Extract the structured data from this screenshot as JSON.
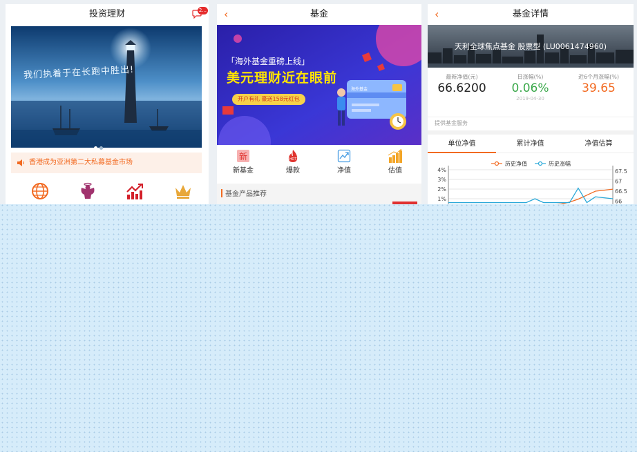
{
  "panel1": {
    "title": "投资理财",
    "badge": "2...",
    "banner_text": "我们执着于在长跑中胜出!",
    "notice": "香港成为亚洲第二大私募基金市场",
    "icons": [
      "globe-icon",
      "angel-icon",
      "trend-icon",
      "crown-icon"
    ]
  },
  "panel2": {
    "title": "基金",
    "banner": {
      "subtitle": "「海外基金重磅上线」",
      "title": "美元理财近在眼前",
      "promo": "开户有礼 豪送158元红包",
      "card_label": "海外基金"
    },
    "nav": [
      {
        "label": "新基金",
        "icon": "new-icon",
        "icon_text": "新"
      },
      {
        "label": "爆款",
        "icon": "hot-icon",
        "icon_text": "HOT"
      },
      {
        "label": "净值",
        "icon": "trend-chart-icon"
      },
      {
        "label": "估值",
        "icon": "bar-coins-icon"
      }
    ],
    "section_title": "基金产品推荐"
  },
  "panel3": {
    "title": "基金详情",
    "fund_name": "天利全球焦点基金 股票型 (LU0061474960)",
    "stats": [
      {
        "label": "最新净值(元)",
        "value": "66.6200",
        "date": ""
      },
      {
        "label": "日涨幅(%)",
        "value": "0.06%",
        "date": "2019-04-30"
      },
      {
        "label": "近6个月涨幅(%)",
        "value": "39.65",
        "date": ""
      }
    ],
    "service_label": "提供基金服务",
    "tabs": [
      "单位净值",
      "累计净值",
      "净值估算"
    ],
    "active_tab": 0
  },
  "colors": {
    "accent": "#f26a21",
    "green": "#3aa84a",
    "red_badge": "#e52b2b"
  },
  "chart_data": {
    "type": "line",
    "title": "",
    "legend": [
      "历史净值",
      "历史涨幅"
    ],
    "y_left_ticks": [
      "4%",
      "3%",
      "2%",
      "1%"
    ],
    "y_right_ticks": [
      "67.5",
      "67",
      "66.5",
      "66"
    ],
    "series": [
      {
        "name": "历史净值",
        "color": "#f26a21",
        "axis": "right",
        "values": [
          65.8,
          65.8,
          65.8,
          65.8,
          65.8,
          65.8,
          65.8,
          65.8,
          65.8,
          65.8,
          65.8,
          65.8,
          65.8,
          65.85,
          65.95,
          66.1,
          66.3,
          66.5,
          66.55,
          66.6
        ]
      },
      {
        "name": "历史涨幅",
        "color": "#2aa8d8",
        "axis": "left",
        "values": [
          0.6,
          0.6,
          0.6,
          0.6,
          0.6,
          0.6,
          0.6,
          0.6,
          0.6,
          0.6,
          1.0,
          0.6,
          0.6,
          0.6,
          0.6,
          2.1,
          0.6,
          1.2,
          1.1,
          1.0
        ]
      }
    ],
    "y_left_range": [
      0.6,
      4
    ],
    "y_right_range": [
      65.8,
      67.5
    ]
  }
}
